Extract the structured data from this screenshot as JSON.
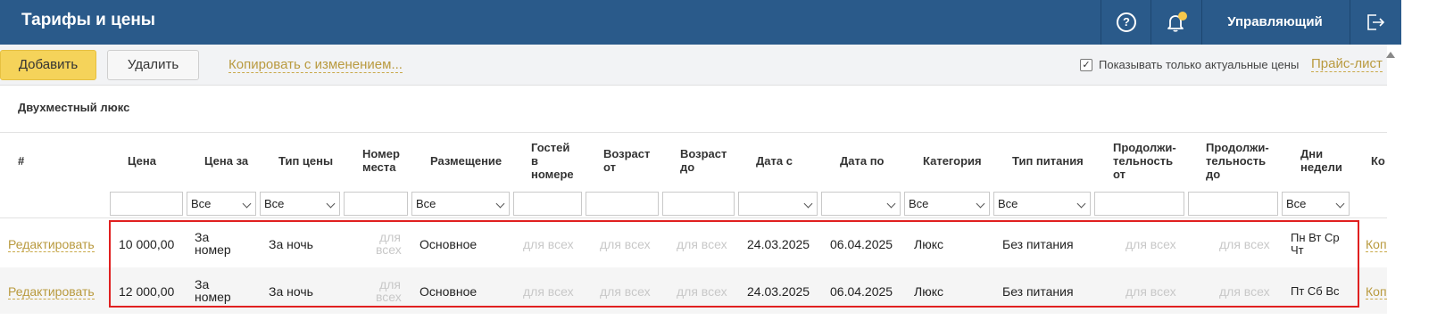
{
  "header": {
    "title": "Тарифы и цены",
    "help_glyph": "?",
    "user": "Управляющий",
    "icons": [
      "help-icon",
      "bell-icon",
      "logout-icon"
    ],
    "brand_color": "#2a5a8a"
  },
  "toolbar": {
    "add_label": "Добавить",
    "delete_label": "Удалить",
    "copy_label": "Копировать с изменением...",
    "checkbox_label": "Показывать только актуальные цены",
    "checkbox_checked": true,
    "pricelist_label": "Прайс-лист"
  },
  "section": {
    "title": "Двухместный люкс"
  },
  "columns": {
    "num": "#",
    "price": "Цена",
    "price_for": "Цена за",
    "price_type": "Тип цены",
    "place_no": [
      "Номер",
      "места"
    ],
    "placement": "Размещение",
    "guests": [
      "Гостей",
      "в",
      "номере"
    ],
    "age_from": [
      "Возраст",
      "от"
    ],
    "age_to": [
      "Возраст",
      "до"
    ],
    "date_from": "Дата с",
    "date_to": "Дата по",
    "category": "Категория",
    "meal": "Тип питания",
    "dur_from": [
      "Продолжи-",
      "тельность",
      "от"
    ],
    "dur_to": [
      "Продолжи-",
      "тельность",
      "до"
    ],
    "weekdays": [
      "Дни",
      "недели"
    ],
    "kop": "Ко"
  },
  "filters": {
    "all": "Все",
    "price_for": "Все",
    "price_type": "Все",
    "placement": "Все",
    "category": "Все",
    "meal": "Все",
    "weekdays": "Все"
  },
  "rows": [
    {
      "edit": "Редактировать",
      "price": "10 000,00",
      "price_for": [
        "За",
        "номер"
      ],
      "price_type": "За ночь",
      "place_no": [
        "для",
        "всех"
      ],
      "placement": "Основное",
      "guests": "для всех",
      "age_from": "для всех",
      "age_to": "для всех",
      "date_from": "24.03.2025",
      "date_to": "06.04.2025",
      "category": "Люкс",
      "meal": "Без питания",
      "dur_from": "для всех",
      "dur_to": "для всех",
      "weekdays": [
        "Пн Вт Ср",
        "Чт"
      ],
      "kop": "Коп"
    },
    {
      "edit": "Редактировать",
      "price": "12 000,00",
      "price_for": [
        "За",
        "номер"
      ],
      "price_type": "За ночь",
      "place_no": [
        "для",
        "всех"
      ],
      "placement": "Основное",
      "guests": "для всех",
      "age_from": "для всех",
      "age_to": "для всех",
      "date_from": "24.03.2025",
      "date_to": "06.04.2025",
      "category": "Люкс",
      "meal": "Без питания",
      "dur_from": "для всех",
      "dur_to": "для всех",
      "weekdays": [
        "Пт Сб Вс"
      ],
      "kop": "Коп"
    }
  ]
}
